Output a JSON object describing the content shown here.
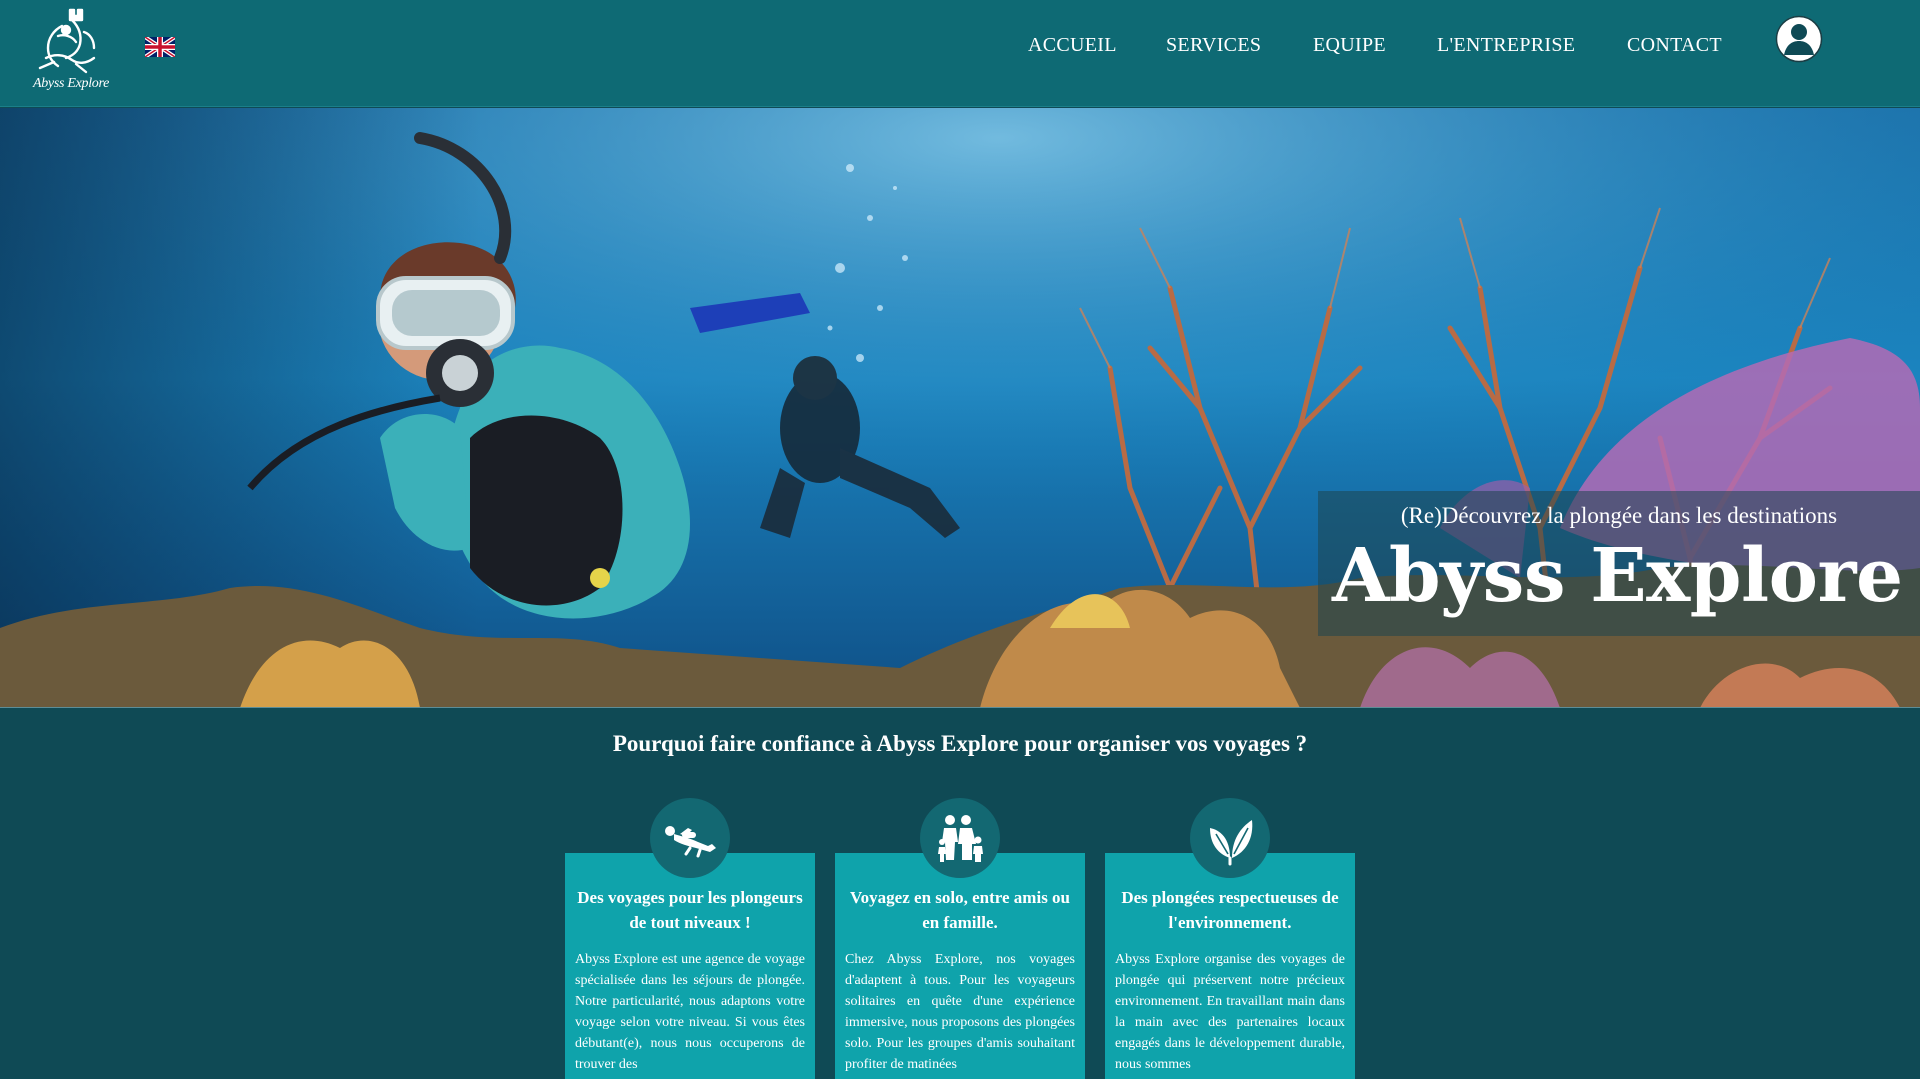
{
  "header": {
    "logo_text": "Abyss Explore",
    "language_flag_icon": "uk-flag-icon",
    "nav": [
      {
        "label": "ACCUEIL"
      },
      {
        "label": "SERVICES"
      },
      {
        "label": "EQUIPE"
      },
      {
        "label": "L'ENTREPRISE"
      },
      {
        "label": "CONTACT"
      }
    ],
    "user_icon": "user-icon"
  },
  "hero": {
    "subtitle": "(Re)Découvrez la plongée dans les destinations",
    "title": "Abyss Explore"
  },
  "why": {
    "title": "Pourquoi faire confiance à Abyss Explore pour organiser vos voyages ?",
    "cards": [
      {
        "icon": "diver-icon",
        "title": "Des voyages pour les plongeurs de tout niveaux !",
        "text": "Abyss Explore est une agence de voyage spécialisée dans les séjours de plongée. Notre particularité, nous adaptons votre voyage selon votre niveau. Si vous êtes débutant(e), nous nous occuperons de trouver des"
      },
      {
        "icon": "family-icon",
        "title": "Voyagez en solo, entre amis ou en famille.",
        "text": "Chez Abyss Explore, nos voyages d'adaptent à tous. Pour les voyageurs solitaires en quête d'une expérience immersive, nous proposons des plongées solo. Pour les groupes d'amis souhaitant profiter de matinées"
      },
      {
        "icon": "leaf-icon",
        "title": "Des plongées respectueuses de l'environnement.",
        "text": "Abyss Explore organise des voyages de plongée qui préservent notre précieux environnement. En travaillant main dans la main avec des partenaires locaux engagés dans le développement durable, nous sommes"
      }
    ]
  },
  "colors": {
    "header_bg": "#0e6a74",
    "page_bg": "#0f4a55",
    "card_bg": "#0fa3ab",
    "icon_circle": "#136872"
  }
}
